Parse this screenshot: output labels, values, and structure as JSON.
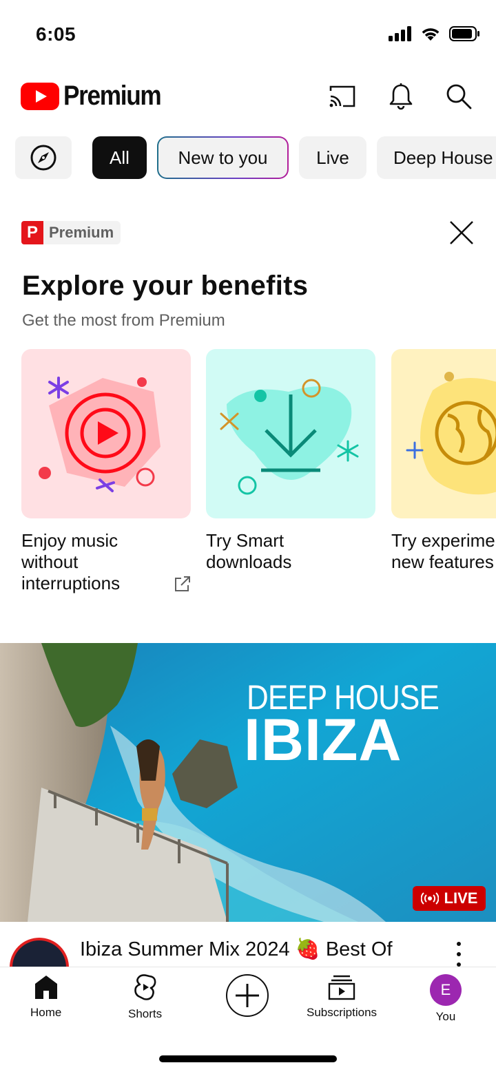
{
  "status_bar": {
    "time": "6:05"
  },
  "header": {
    "brand": "Premium",
    "icons": [
      "cast-icon",
      "bell-icon",
      "search-icon"
    ]
  },
  "chips": [
    {
      "label": "",
      "icon": "compass-icon"
    },
    {
      "label": "All",
      "selected": true
    },
    {
      "label": "New to you"
    },
    {
      "label": "Live"
    },
    {
      "label": "Deep House"
    }
  ],
  "premium_card": {
    "badge_letter": "P",
    "badge_text": "Premium",
    "title": "Explore your benefits",
    "subtitle": "Get the most from Premium",
    "benefits": [
      {
        "label": "Enjoy music without interruptions",
        "color": "#ffe0e3"
      },
      {
        "label": "Try Smart downloads",
        "color": "#d1fbf5"
      },
      {
        "label": "Try experimental new features",
        "color": "#fff2c0"
      }
    ]
  },
  "video": {
    "thumb_line1": "DEEP HOUSE",
    "thumb_line2": "IBIZA",
    "live_label": "LIVE",
    "title": "Ibiza Summer Mix 2024 🍓 Best Of"
  },
  "nav": {
    "home": "Home",
    "shorts": "Shorts",
    "subscriptions": "Subscriptions",
    "you": "You",
    "you_initial": "E"
  },
  "colors": {
    "brand_red": "#ff0000",
    "live_red": "#cc0000",
    "avatar_purple": "#9c27b0"
  }
}
